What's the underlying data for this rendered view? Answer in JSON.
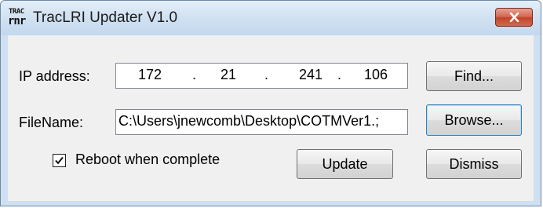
{
  "window": {
    "title": "TracLRI Updater V1.0",
    "icon_text_top": "TRAC",
    "icon_text_bottom": "rnr"
  },
  "ip": {
    "label": "IP address:",
    "octets": [
      "172",
      "21",
      "241",
      "106"
    ],
    "separator": "."
  },
  "file": {
    "label": "FileName:",
    "value": "C:\\Users\\jnewcomb\\Desktop\\COTMVer1.;"
  },
  "options": {
    "reboot_label": "Reboot when complete",
    "reboot_checked": true
  },
  "buttons": {
    "find": "Find...",
    "browse": "Browse...",
    "update": "Update",
    "dismiss": "Dismiss"
  },
  "icons": {
    "close": "close-icon",
    "check": "checkmark-icon",
    "app": "app-icon"
  },
  "colors": {
    "titlebar": "#cfe0f1",
    "client": "#f0f0f0",
    "close_button": "#c94a30"
  }
}
